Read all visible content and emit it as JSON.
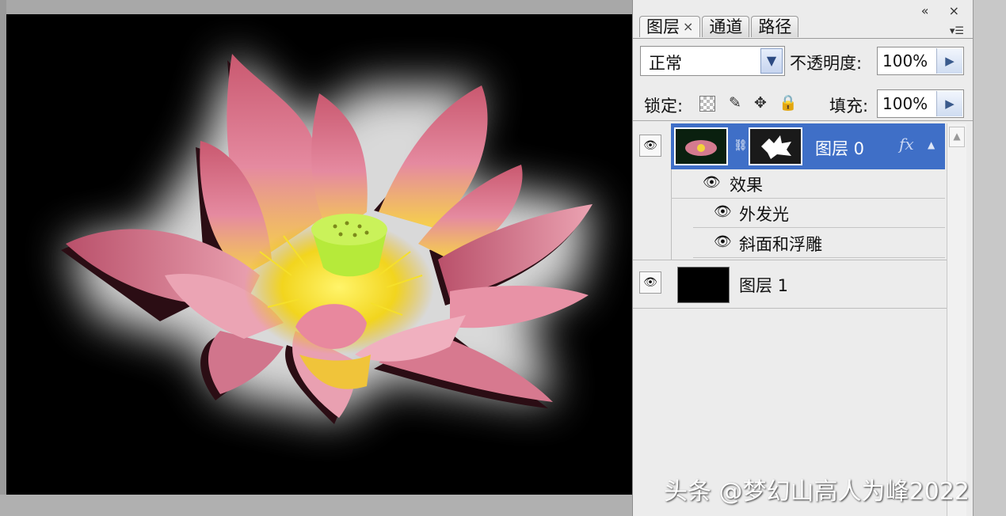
{
  "panel": {
    "tabs": [
      {
        "label": "图层",
        "close": "×",
        "active": true
      },
      {
        "label": "通道",
        "active": false
      },
      {
        "label": "路径",
        "active": false
      }
    ],
    "window_controls": "« ×",
    "menu_icon": "▾☰",
    "blend_mode": "正常",
    "opacity_label": "不透明度:",
    "opacity_value": "100%",
    "lock_label": "锁定:",
    "fill_label": "填充:",
    "fill_value": "100%",
    "layers": [
      {
        "name": "图层 0",
        "selected": true,
        "visible": true,
        "fx": "fx",
        "effects_label": "效果",
        "effects": [
          "外发光",
          "斜面和浮雕"
        ]
      },
      {
        "name": "图层 1",
        "selected": false,
        "visible": true
      }
    ]
  },
  "watermark": "头条 @梦幻山高人为峰2022",
  "colors": {
    "selection": "#3f6fc7",
    "panel_bg": "#ececec",
    "canvas_bg": "#000000",
    "petal": "#e07a96"
  },
  "icons": {
    "eye": "eye-icon",
    "lock_transparent": "checker-icon",
    "lock_paint": "brush-icon",
    "lock_move": "move-icon",
    "lock_all": "padlock-icon"
  }
}
